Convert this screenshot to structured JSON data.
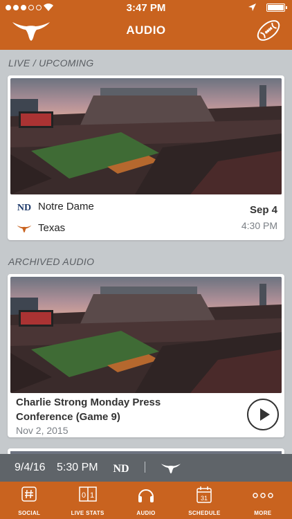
{
  "status_bar": {
    "time": "3:47 PM"
  },
  "header": {
    "title": "AUDIO",
    "logo_icon": "longhorn-icon",
    "right_icon": "football-icon"
  },
  "sections": {
    "live_label": "LIVE / UPCOMING",
    "archived_label": "ARCHIVED AUDIO"
  },
  "live_game": {
    "home_team": "Notre Dame",
    "away_team": "Texas",
    "date": "Sep 4",
    "time": "4:30 PM"
  },
  "archived": {
    "title": "Charlie Strong Monday Press Conference (Game 9)",
    "date": "Nov 2, 2015"
  },
  "now_playing": {
    "date": "9/4/16",
    "time": "5:30 PM"
  },
  "tabs": [
    {
      "label": "SOCIAL",
      "icon": "hashtag-icon"
    },
    {
      "label": "LIVE STATS",
      "icon": "scoreboard-icon"
    },
    {
      "label": "AUDIO",
      "icon": "headphones-icon"
    },
    {
      "label": "SCHEDULE",
      "icon": "calendar-icon",
      "badge": "31"
    },
    {
      "label": "MORE",
      "icon": "more-dots-icon"
    }
  ],
  "colors": {
    "brand": "#c9631f",
    "background": "#c5c9cc",
    "now_bar": "#5f6469"
  }
}
